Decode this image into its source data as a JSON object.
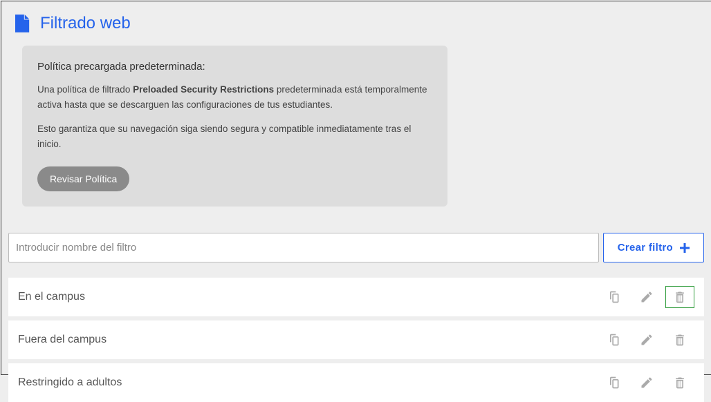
{
  "header": {
    "title": "Filtrado web"
  },
  "policy_box": {
    "title": "Política precargada predeterminada:",
    "line1_before": "Una política de filtrado ",
    "line1_bold": "Preloaded Security Restrictions",
    "line1_after": " predeterminada está temporalmente activa hasta que se descarguen las configuraciones de tus estudiantes.",
    "line2": "Esto garantiza que su navegación siga siendo segura y compatible inmediatamente tras el inicio.",
    "button_label": "Revisar Política"
  },
  "input_row": {
    "placeholder": "Introducir nombre del filtro",
    "create_label": "Crear filtro"
  },
  "filters": [
    {
      "name": "En el campus",
      "delete_highlight": true
    },
    {
      "name": "Fuera del campus",
      "delete_highlight": false
    },
    {
      "name": "Restringido a adultos",
      "delete_highlight": false
    }
  ]
}
